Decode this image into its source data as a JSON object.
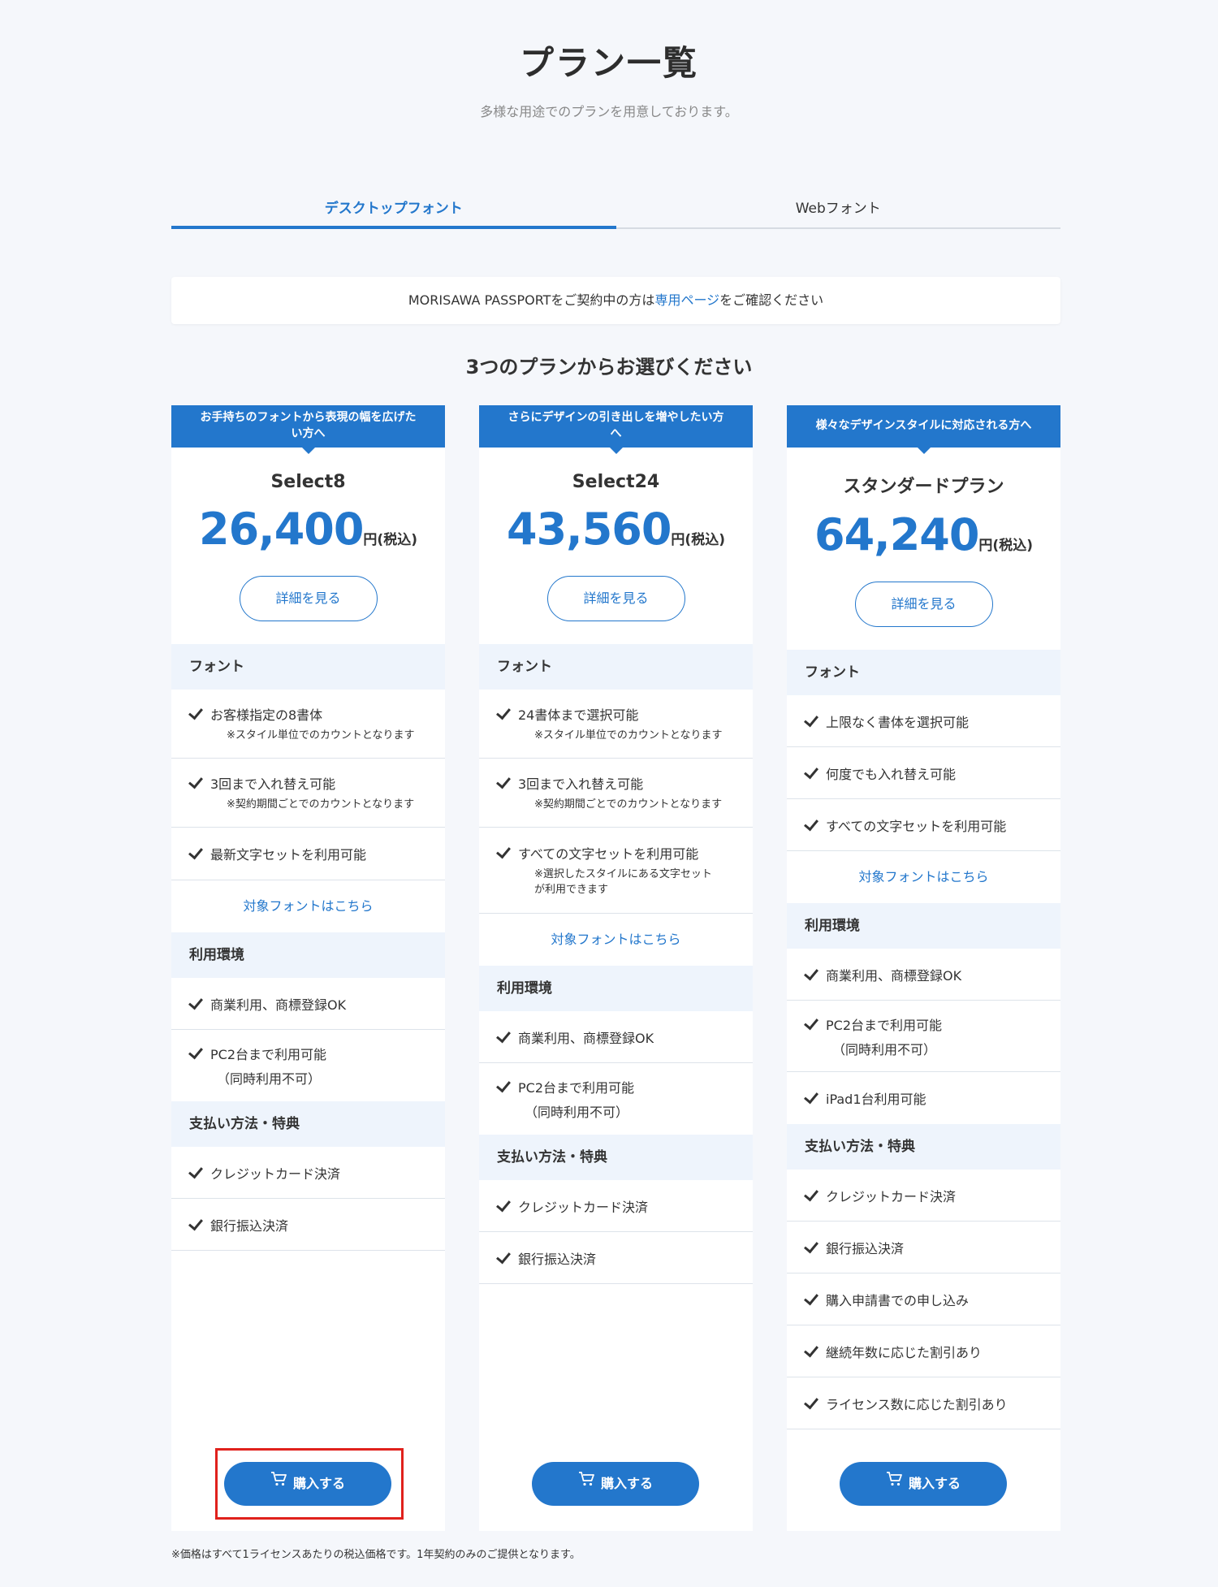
{
  "header": {
    "title": "プラン一覧",
    "subtitle": "多様な用途でのプランを用意しております。"
  },
  "tabs": [
    {
      "label": "デスクトップフォント",
      "active": true
    },
    {
      "label": "Webフォント",
      "active": false
    }
  ],
  "notice": {
    "before": "MORISAWA PASSPORTをご契約中の方は",
    "link": "専用ページ",
    "after": "をご確認ください"
  },
  "choose_heading": "3つのプランからお選びください",
  "plans": [
    {
      "banner": "お手持ちのフォントから表現の幅を広げたい方へ",
      "name": "Select8",
      "price": "26,400",
      "price_unit": "円(税込)",
      "detail_label": "詳細を見る",
      "font_section": "フォント",
      "font_features": [
        {
          "main": "お客様指定の8書体",
          "note": "※スタイル単位でのカウントとなります"
        },
        {
          "main": "3回まで入れ替え可能",
          "note": "※契約期間ごとでのカウントとなります"
        },
        {
          "main": "最新文字セットを利用可能"
        }
      ],
      "font_link": "対象フォントはこちら",
      "env_section": "利用環境",
      "env_features": [
        {
          "main": "商業利用、商標登録OK"
        },
        {
          "main": "PC2台まで利用可能",
          "sub": "（同時利用不可）"
        }
      ],
      "pay_section": "支払い方法・特典",
      "pay_features": [
        {
          "main": "クレジットカード決済"
        },
        {
          "main": "銀行振込決済"
        }
      ],
      "buy_label": "購入する"
    },
    {
      "banner": "さらにデザインの引き出しを増やしたい方へ",
      "name": "Select24",
      "price": "43,560",
      "price_unit": "円(税込)",
      "detail_label": "詳細を見る",
      "font_section": "フォント",
      "font_features": [
        {
          "main": "24書体まで選択可能",
          "note": "※スタイル単位でのカウントとなります"
        },
        {
          "main": "3回まで入れ替え可能",
          "note": "※契約期間ごとでのカウントとなります"
        },
        {
          "main": "すべての文字セットを利用可能",
          "note": "※選択したスタイルにある文字セットが利用できます"
        }
      ],
      "font_link": "対象フォントはこちら",
      "env_section": "利用環境",
      "env_features": [
        {
          "main": "商業利用、商標登録OK"
        },
        {
          "main": "PC2台まで利用可能",
          "sub": "（同時利用不可）"
        }
      ],
      "pay_section": "支払い方法・特典",
      "pay_features": [
        {
          "main": "クレジットカード決済"
        },
        {
          "main": "銀行振込決済"
        }
      ],
      "buy_label": "購入する"
    },
    {
      "banner": "様々なデザインスタイルに対応される方へ",
      "name": "スタンダードプラン",
      "price": "64,240",
      "price_unit": "円(税込)",
      "detail_label": "詳細を見る",
      "font_section": "フォント",
      "font_features": [
        {
          "main": "上限なく書体を選択可能"
        },
        {
          "main": "何度でも入れ替え可能"
        },
        {
          "main": "すべての文字セットを利用可能"
        }
      ],
      "font_link": "対象フォントはこちら",
      "env_section": "利用環境",
      "env_features": [
        {
          "main": "商業利用、商標登録OK"
        },
        {
          "main": "PC2台まで利用可能",
          "sub": "（同時利用不可）"
        },
        {
          "main": "iPad1台利用可能"
        }
      ],
      "pay_section": "支払い方法・特典",
      "pay_features": [
        {
          "main": "クレジットカード決済"
        },
        {
          "main": "銀行振込決済"
        },
        {
          "main": "購入申請書での申し込み"
        },
        {
          "main": "継続年数に応じた割引あり"
        },
        {
          "main": "ライセンス数に応じた割引あり"
        }
      ],
      "buy_label": "購入する"
    }
  ],
  "footnote": "※価格はすべて1ライセンスあたりの税込価格です。1年契約のみのご提供となります。",
  "icons": {
    "cart": "cart-icon",
    "check": "check-icon"
  },
  "colors": {
    "accent": "#2377cc",
    "highlight": "#e0211c",
    "background": "#f5f7fb"
  }
}
